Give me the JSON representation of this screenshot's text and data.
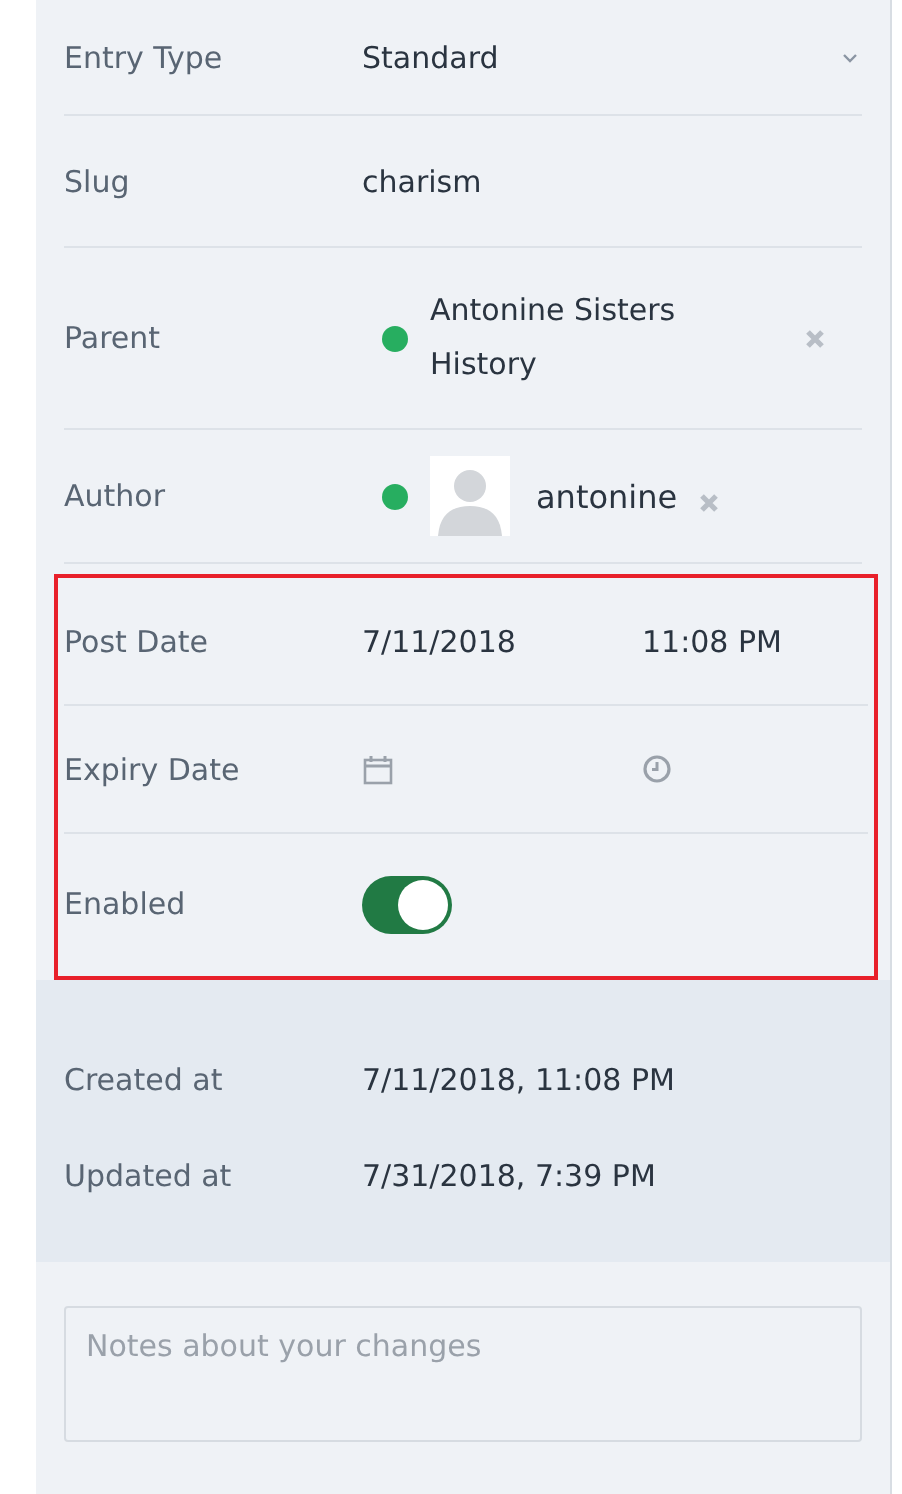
{
  "fields": [
    {
      "kind": "select",
      "label": "Entry Type",
      "value": "Standard"
    },
    {
      "kind": "text",
      "label": "Slug",
      "value": "charism"
    },
    {
      "kind": "relation",
      "label": "Parent",
      "value": "Antonine Sisters History",
      "color": "#27ae60"
    },
    {
      "kind": "user",
      "label": "Author",
      "value": "antonine",
      "color": "#27ae60"
    }
  ],
  "highlighted_fields": [
    {
      "kind": "datetime",
      "label": "Post Date",
      "date": "7/11/2018",
      "time": "11:08 PM"
    },
    {
      "kind": "datetime",
      "label": "Expiry Date"
    },
    {
      "kind": "toggle",
      "label": "Enabled",
      "on": true
    }
  ],
  "meta": [
    {
      "label": "Created at",
      "value": "7/11/2018, 11:08 PM"
    },
    {
      "label": "Updated at",
      "value": "7/31/2018, 7:39 PM"
    }
  ],
  "notes": {
    "placeholder": "Notes about your changes"
  }
}
